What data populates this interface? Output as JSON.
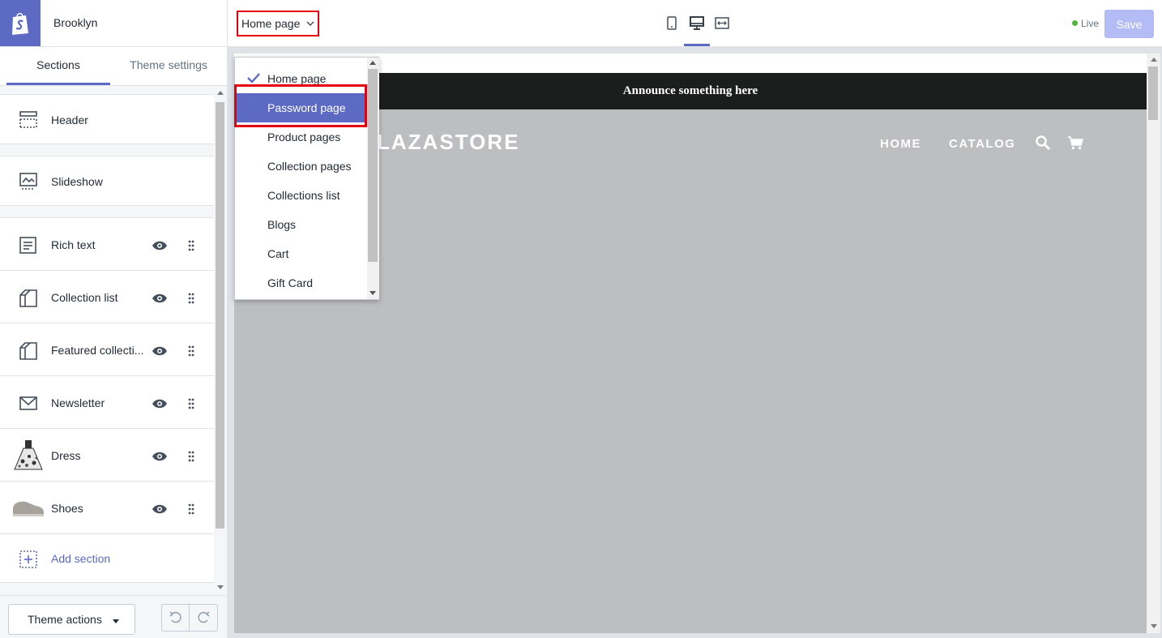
{
  "sidebar": {
    "store_name": "Brooklyn",
    "tabs": [
      "Sections",
      "Theme settings"
    ],
    "sections": [
      {
        "label": "Header",
        "icon": "header-icon"
      },
      {
        "label": "Slideshow",
        "icon": "slideshow-icon"
      },
      {
        "label": "Rich text",
        "icon": "rich-text-icon"
      },
      {
        "label": "Collection list",
        "icon": "collection-icon"
      },
      {
        "label": "Featured collecti...",
        "icon": "collection-icon"
      },
      {
        "label": "Newsletter",
        "icon": "mail-icon"
      },
      {
        "label": "Dress",
        "icon": "dress-thumbnail"
      },
      {
        "label": "Shoes",
        "icon": "shoes-thumbnail"
      }
    ],
    "add_section_label": "Add section",
    "theme_actions_label": "Theme actions"
  },
  "topbar": {
    "page_select": "Home page",
    "status": "Live",
    "save_label": "Save"
  },
  "dropdown": {
    "options": [
      "Home page",
      "Password page",
      "Product pages",
      "Collection pages",
      "Collections list",
      "Blogs",
      "Cart",
      "Gift Card"
    ],
    "checked": "Home page",
    "highlighted": "Password page"
  },
  "preview": {
    "announcement": "Announce something here",
    "brand": "LAZASTORE",
    "nav": [
      "HOME",
      "CATALOG"
    ]
  },
  "colors": {
    "accent": "#5c6ac4",
    "highlight_border": "#e4000f",
    "live_dot": "#50b83c",
    "save_disabled": "#b3bcf5"
  }
}
